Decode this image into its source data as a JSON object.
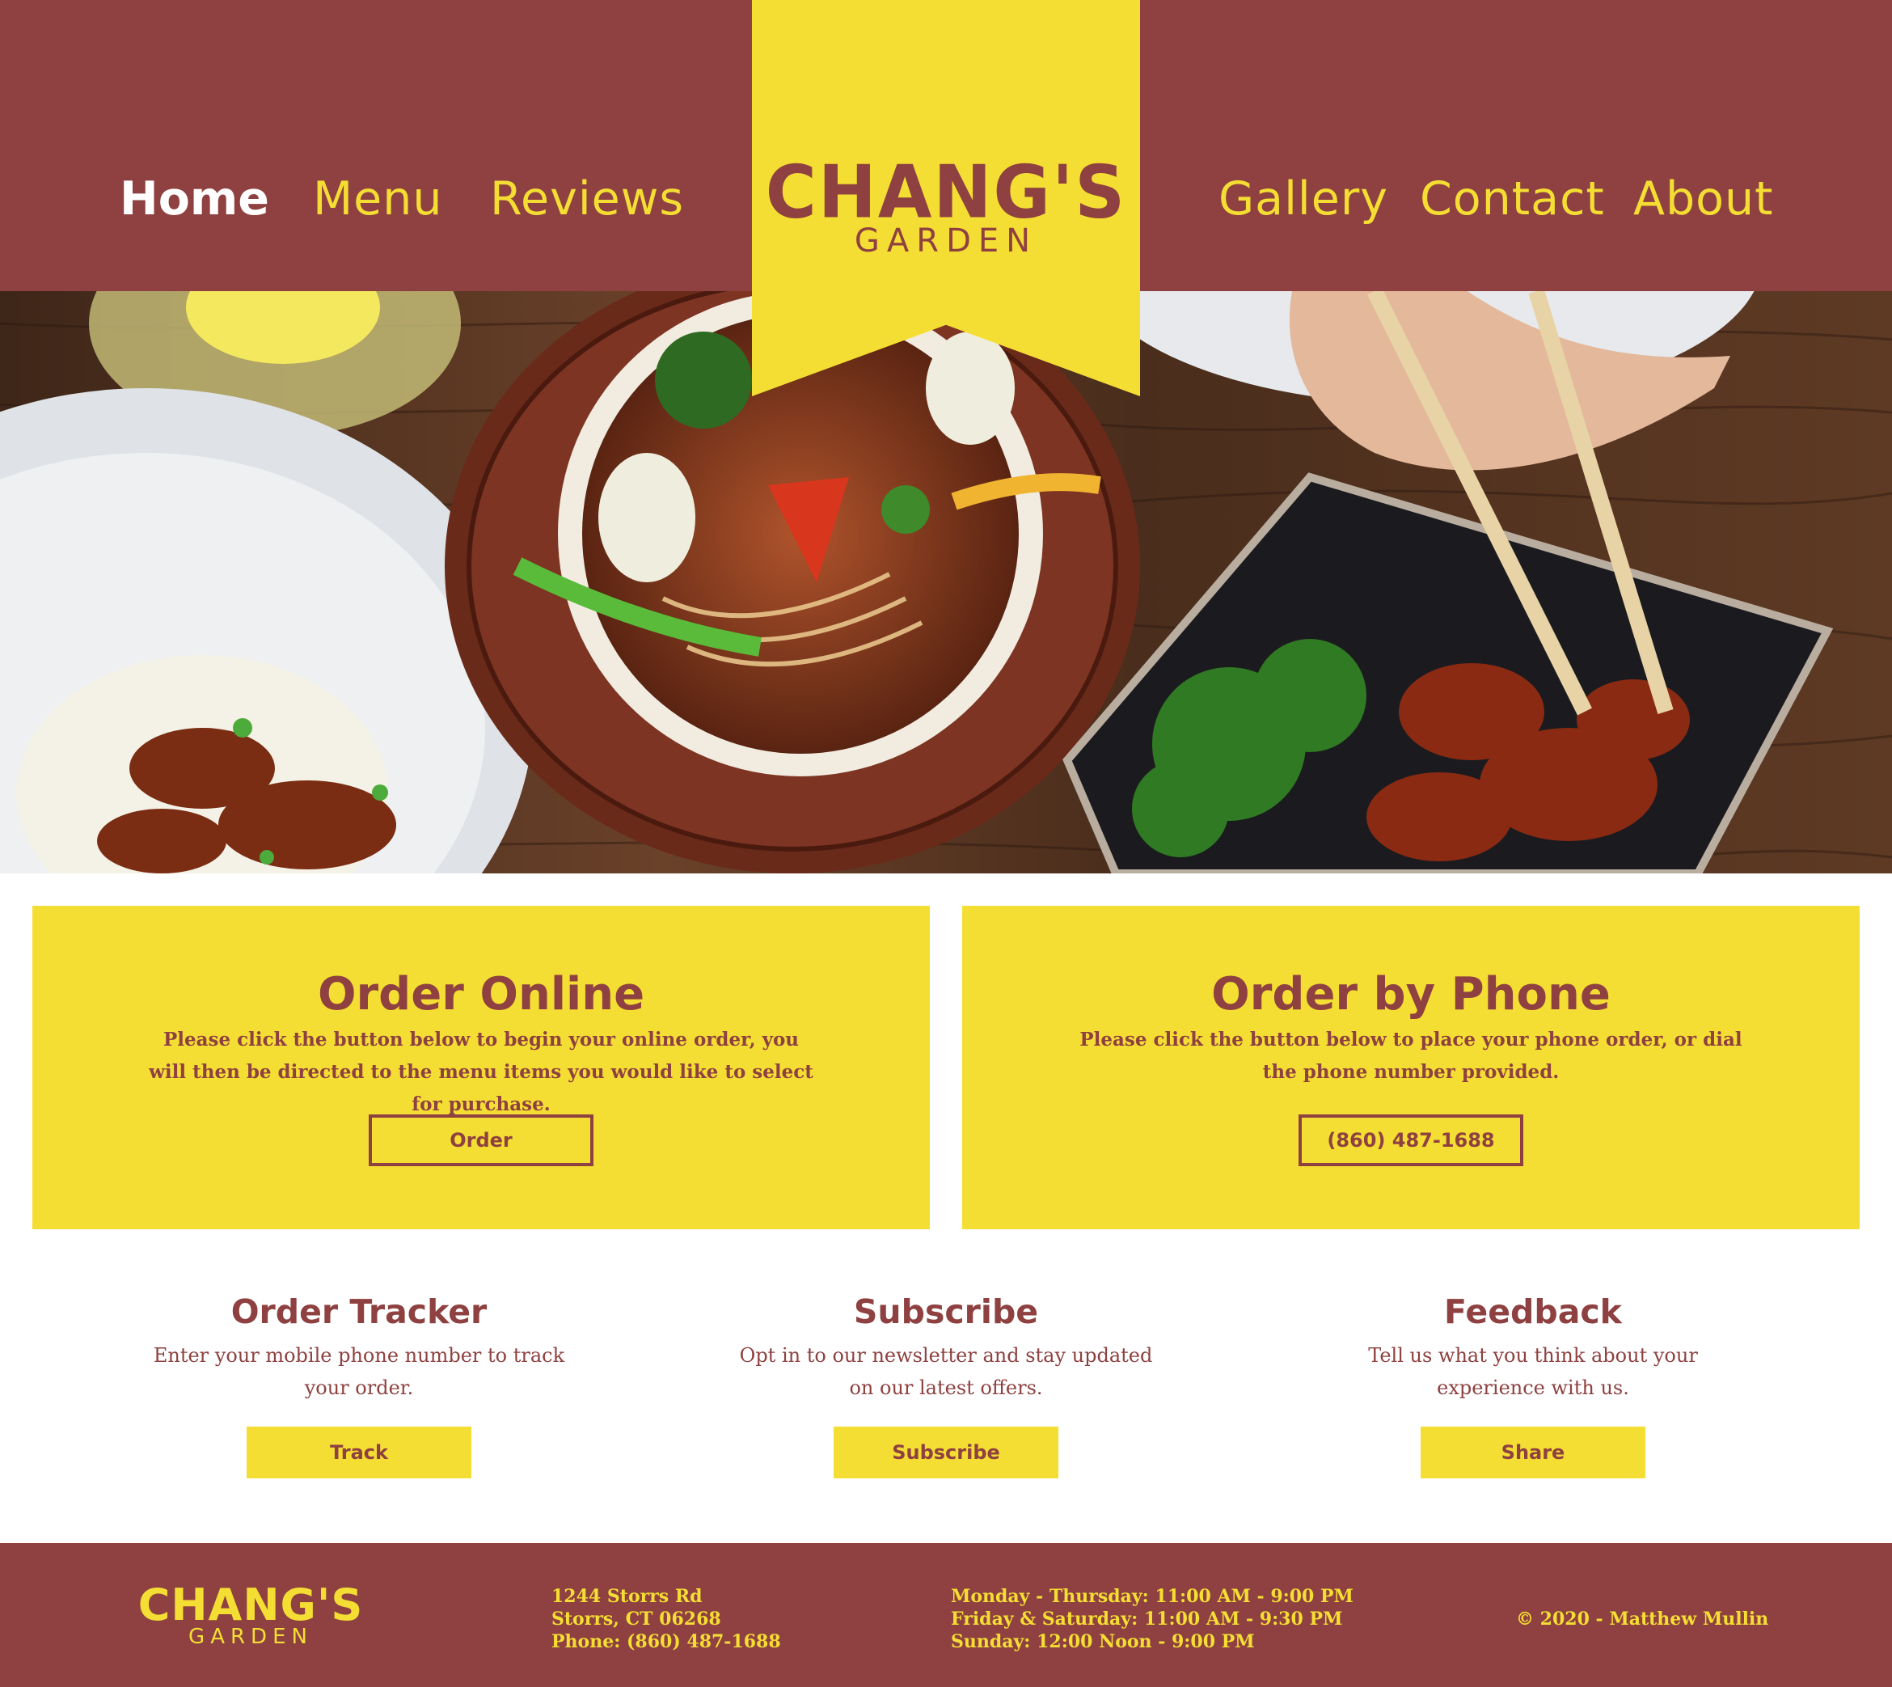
{
  "colors": {
    "brand": "#8e4140",
    "accent": "#f5de33",
    "white": "#ffffff"
  },
  "nav": {
    "left": [
      {
        "label": "Home",
        "active": true
      },
      {
        "label": "Menu"
      },
      {
        "label": "Reviews"
      }
    ],
    "right": [
      {
        "label": "Gallery"
      },
      {
        "label": "Contact"
      },
      {
        "label": "About"
      }
    ]
  },
  "logo": {
    "line1": "CHANG'S",
    "line2": "GARDEN"
  },
  "hero": {
    "image": "food-photo"
  },
  "order_online": {
    "title": "Order Online",
    "text": "Please click the button below to begin your online order, you will then be directed to the menu items you would like to select for purchase.",
    "button": "Order"
  },
  "order_phone": {
    "title": "Order by Phone",
    "text": "Please click the button below to place your phone order, or dial the phone number provided.",
    "button": "(860) 487-1688"
  },
  "widgets": {
    "tracker": {
      "title": "Order Tracker",
      "text": "Enter your mobile phone number to track your order.",
      "button": "Track"
    },
    "subscribe": {
      "title": "Subscribe",
      "text": "Opt in to our newsletter and stay updated on our latest offers.",
      "button": "Subscribe"
    },
    "feedback": {
      "title": "Feedback",
      "text": "Tell us what you think about your experience with us.",
      "button": "Share"
    }
  },
  "footer": {
    "logo_line1": "CHANG'S",
    "logo_line2": "GARDEN",
    "address": [
      "1244 Storrs Rd",
      "Storrs, CT 06268",
      "Phone: (860) 487-1688"
    ],
    "hours": [
      "Monday - Thursday: 11:00 AM - 9:00 PM",
      "Friday & Saturday: 11:00 AM - 9:30 PM",
      "Sunday: 12:00 Noon - 9:00 PM"
    ],
    "copyright": "© 2020 - Matthew Mullin"
  }
}
